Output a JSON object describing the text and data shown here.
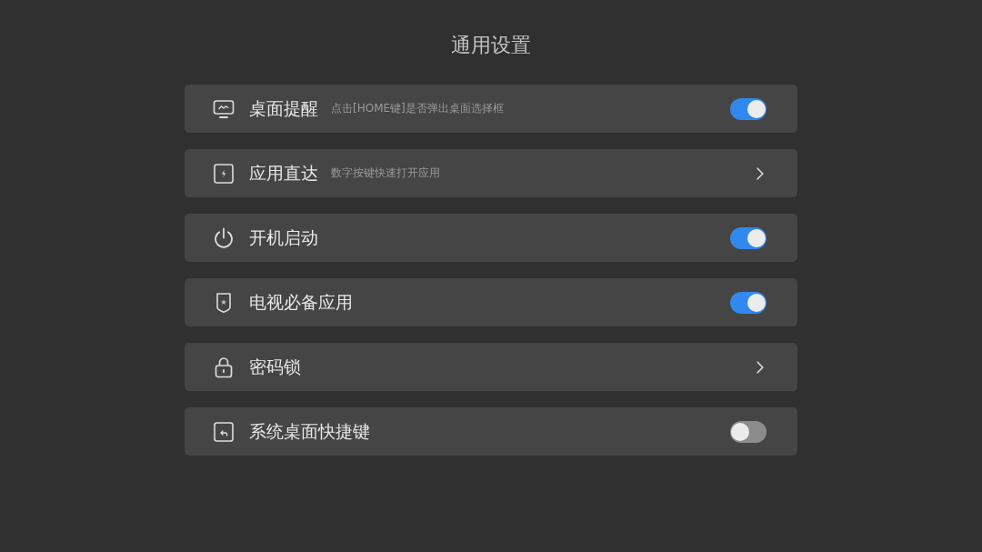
{
  "title": "通用设置",
  "items": [
    {
      "kind": "toggle",
      "label": "桌面提醒",
      "description": "点击[HOME键]是否弹出桌面选择框",
      "on": true
    },
    {
      "kind": "link",
      "label": "应用直达",
      "description": "数字按键快速打开应用"
    },
    {
      "kind": "toggle",
      "label": "开机启动",
      "on": true
    },
    {
      "kind": "toggle",
      "label": "电视必备应用",
      "on": true
    },
    {
      "kind": "link",
      "label": "密码锁"
    },
    {
      "kind": "toggle",
      "label": "系统桌面快捷键",
      "on": false
    }
  ]
}
